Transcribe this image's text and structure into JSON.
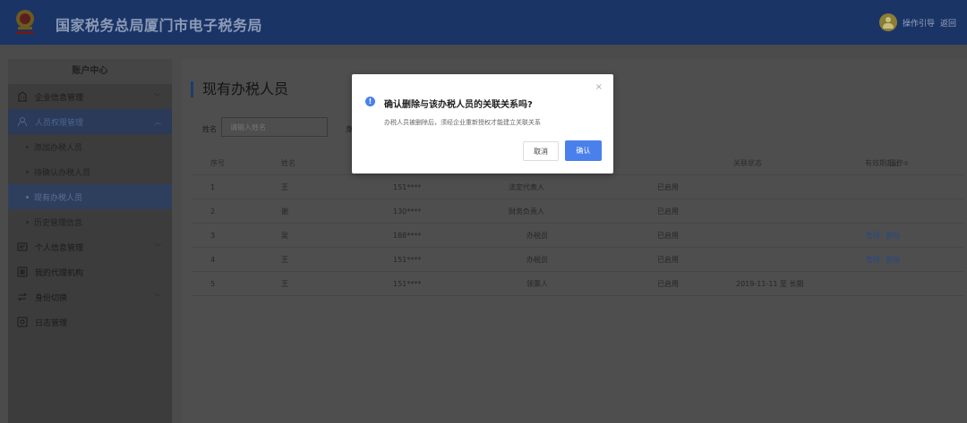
{
  "header": {
    "title": "国家税务总局厦门市电子税务局",
    "guide_link": "操作引导",
    "back_link": "返回"
  },
  "sidebar": {
    "title": "账户中心",
    "groups": [
      {
        "label": "企业信息管理",
        "icon": "building-icon"
      },
      {
        "label": "人员权限管理",
        "icon": "user-permission-icon"
      },
      {
        "label": "个人信息管理",
        "icon": "id-card-icon"
      },
      {
        "label": "我的代理机构",
        "icon": "agency-icon"
      },
      {
        "label": "身份切换",
        "icon": "switch-icon"
      },
      {
        "label": "日志管理",
        "icon": "log-icon"
      }
    ],
    "sub_items": [
      "添加办税人员",
      "待确认办税人员",
      "现有办税人员",
      "历史管理信息"
    ]
  },
  "main": {
    "page_title": "现有办税人员",
    "filter": {
      "name_label": "姓名",
      "name_placeholder": "请输入姓名",
      "second_label_fragment": "身"
    },
    "table": {
      "columns": [
        "序号",
        "姓名",
        "",
        "",
        "关联状态",
        "有效期起止 ≑",
        "操作"
      ],
      "rows": [
        {
          "no": "1",
          "name": "王",
          "id": "151****",
          "role": "法定代表人",
          "status": "已启用",
          "period": "",
          "ops": []
        },
        {
          "no": "2",
          "name": "谢",
          "id": "130****",
          "role": "财务负责人",
          "status": "已启用",
          "period": "",
          "ops": []
        },
        {
          "no": "3",
          "name": "吴",
          "id": "188****",
          "role": "办税员",
          "status": "已启用",
          "period": "",
          "ops": [
            "管理",
            "删除"
          ]
        },
        {
          "no": "4",
          "name": "王",
          "id": "151****",
          "role": "办税员",
          "status": "已启用",
          "period": "",
          "ops": [
            "管理",
            "删除"
          ]
        },
        {
          "no": "5",
          "name": "王",
          "id": "151****",
          "role": "领票人",
          "status": "已启用",
          "period": "2019-11-11 至 长期",
          "ops": []
        }
      ]
    }
  },
  "modal": {
    "title": "确认删除与该办税人员的关联关系吗?",
    "description": "办税人员被删除后，须经企业重新授权才能建立关联关系",
    "cancel_label": "取消",
    "confirm_label": "确认",
    "close_symbol": "×"
  },
  "colors": {
    "header_bg": "#1a3466",
    "accent": "#4a80ec",
    "overlay_bg": "#4b4b4b"
  }
}
